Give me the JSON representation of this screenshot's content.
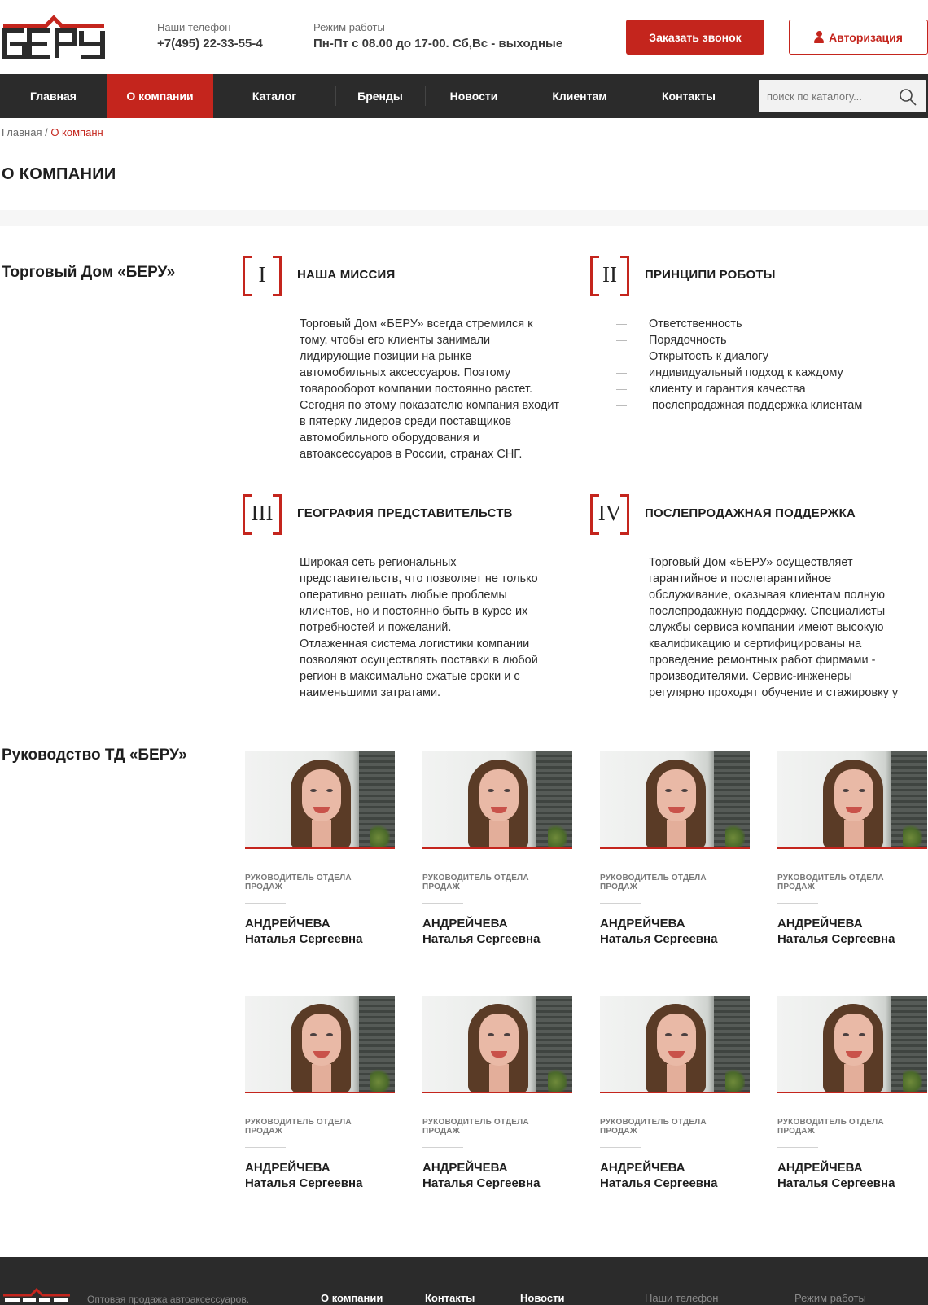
{
  "header": {
    "phone_label": "Наши телефон",
    "phone": "+7(495) 22-33-55-4",
    "hours_label": "Режим работы",
    "hours": "Пн-Пт с 08.00 до 17-00. Сб,Вс - выходные",
    "call_button": "Заказать звонок",
    "auth_button": "Авторизация",
    "logo_text": "БЕРУ"
  },
  "nav": {
    "items": [
      {
        "label": "Главная"
      },
      {
        "label": "О компании"
      },
      {
        "label": "Каталог"
      },
      {
        "label": "Бренды"
      },
      {
        "label": "Новости"
      },
      {
        "label": "Клиентам"
      },
      {
        "label": "Контакты"
      }
    ],
    "active_index": 1,
    "search_placeholder": "поиск по каталогу..."
  },
  "breadcrumb": {
    "home": "Главная",
    "sep": " / ",
    "current": "О компанн"
  },
  "page_title": "О КОМПАНИИ",
  "company": {
    "heading": "Торговый Дом «БЕРУ»",
    "sections": [
      {
        "num": "I",
        "title": "НАША МИССИЯ",
        "text": "Торговый Дом «БЕРУ» всегда стремился  к\nтому, чтобы его клиенты занимали\nлидирующие позиции на рынке\nавтомобильных аксессуаров. Поэтому\nтоварооборот компании постоянно растет.\nСегодня по этому показателю компания входит\nв пятерку лидеров среди поставщиков\nавтомобильного оборудования и\nавтоаксессуаров в России, странах СНГ."
      },
      {
        "num": "II",
        "title": "ПРИНЦИПИ РОБОТЫ",
        "list": [
          "Ответственность",
          "Порядочность",
          "Открытость к диалогу",
          "индивидуальный подход к каждому\nклиенту и гарантия качества",
          " послепродажная поддержка клиентам"
        ]
      },
      {
        "num": "III",
        "title": "ГЕОГРАФИЯ ПРЕДСТАВИТЕЛЬСТВ",
        "text": "Широкая сеть региональных\nпредставительств, что позволяет не только\nоперативно решать любые проблемы\nклиентов, но и постоянно быть в курсе их\nпотребностей и пожеланий.\nОтлаженная система  логистики компании\nпозволяют осуществлять поставки в любой\nрегион в максимально сжатые сроки и с\nнаименьшими затратами."
      },
      {
        "num": "IV",
        "title": "ПОСЛЕПРОДАЖНАЯ ПОДДЕРЖКА",
        "text": "Торговый Дом «БЕРУ»  осуществляет\nгарантийное и послегарантийное\nобслуживание, оказывая клиентам полную\nпослепродажную поддержку. Специалисты\nслужбы сервиса компании имеют высокую\nквалификацию и сертифицированы на\nпроведение ремонтных работ фирмами -\nпроизводителями. Сервис-инженеры\nрегулярно проходят обучение и стажировку у"
      }
    ]
  },
  "leadership": {
    "heading": "Руководство ТД «БЕРУ»",
    "people": [
      {
        "role": "РУКОВОДИТЕЛЬ ОТДЕЛА\nПРОДАЖ",
        "surname": "АНДРЕЙЧЕВА",
        "name": "Наталья Сергеевна"
      },
      {
        "role": "РУКОВОДИТЕЛЬ ОТДЕЛА\nПРОДАЖ",
        "surname": "АНДРЕЙЧЕВА",
        "name": "Наталья Сергеевна"
      },
      {
        "role": "РУКОВОДИТЕЛЬ ОТДЕЛА\nПРОДАЖ",
        "surname": "АНДРЕЙЧЕВА",
        "name": "Наталья Сергеевна"
      },
      {
        "role": "РУКОВОДИТЕЛЬ ОТДЕЛА\nПРОДАЖ",
        "surname": "АНДРЕЙЧЕВА",
        "name": "Наталья Сергеевна"
      },
      {
        "role": "РУКОВОДИТЕЛЬ ОТДЕЛА\nПРОДАЖ",
        "surname": "АНДРЕЙЧЕВА",
        "name": "Наталья Сергеевна"
      },
      {
        "role": "РУКОВОДИТЕЛЬ ОТДЕЛА\nПРОДАЖ",
        "surname": "АНДРЕЙЧЕВА",
        "name": "Наталья Сергеевна"
      },
      {
        "role": "РУКОВОДИТЕЛЬ ОТДЕЛА\nПРОДАЖ",
        "surname": "АНДРЕЙЧЕВА",
        "name": "Наталья Сергеевна"
      },
      {
        "role": "РУКОВОДИТЕЛЬ ОТДЕЛА\nПРОДАЖ",
        "surname": "АНДРЕЙЧЕВА",
        "name": "Наталья Сергеевна"
      }
    ]
  },
  "footer": {
    "tagline": "Оптовая продажа автоаксессуаров.",
    "links": [
      "О компании",
      "Контакты",
      "Новости"
    ],
    "phone_label": "Наши телефон",
    "hours_label": "Режим работы"
  },
  "colors": {
    "accent": "#c4251d",
    "dark": "#2b2b2b",
    "text": "#1e1e1e"
  },
  "icons": {
    "search": "search-icon",
    "user": "user-icon"
  }
}
